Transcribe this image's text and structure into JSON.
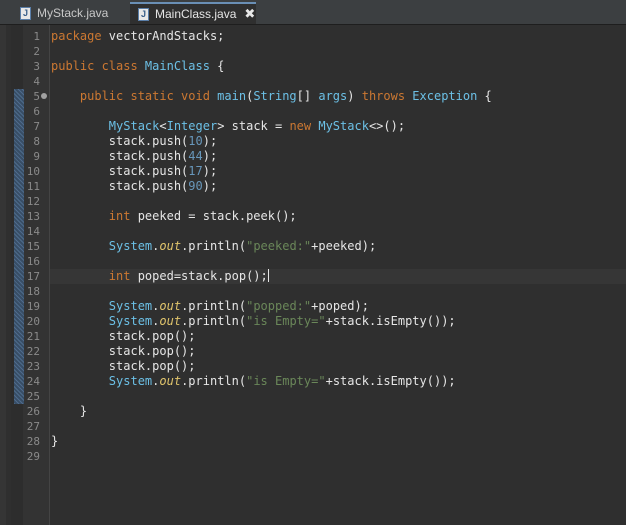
{
  "tabs": [
    {
      "label": "MyStack.java",
      "icon": "java-file-icon",
      "active": false
    },
    {
      "label": "MainClass.java",
      "icon": "java-file-icon",
      "active": true
    }
  ],
  "tab_close": "✖",
  "editor": {
    "line_numbers": [
      "1",
      "2",
      "3",
      "4",
      "5",
      "6",
      "7",
      "8",
      "9",
      "10",
      "11",
      "12",
      "13",
      "14",
      "15",
      "16",
      "17",
      "18",
      "19",
      "20",
      "21",
      "22",
      "23",
      "24",
      "25",
      "26",
      "27",
      "28",
      "29"
    ],
    "current_line": 17,
    "lines": [
      [
        {
          "t": "package ",
          "c": "kw"
        },
        {
          "t": "vectorAndStacks;",
          "c": "pl"
        }
      ],
      [],
      [
        {
          "t": "public class ",
          "c": "kw"
        },
        {
          "t": "MainClass",
          "c": "ms"
        },
        {
          "t": " {",
          "c": "pl"
        }
      ],
      [],
      [
        {
          "t": "    public static void ",
          "c": "kw"
        },
        {
          "t": "main",
          "c": "ms"
        },
        {
          "t": "(",
          "c": "pl"
        },
        {
          "t": "String",
          "c": "ms"
        },
        {
          "t": "[] ",
          "c": "pl"
        },
        {
          "t": "args",
          "c": "ms"
        },
        {
          "t": ") ",
          "c": "pl"
        },
        {
          "t": "throws ",
          "c": "kw"
        },
        {
          "t": "Exception",
          "c": "ms"
        },
        {
          "t": " {",
          "c": "pl"
        }
      ],
      [],
      [
        {
          "t": "        ",
          "c": "pl"
        },
        {
          "t": "MyStack",
          "c": "ms"
        },
        {
          "t": "<",
          "c": "pl"
        },
        {
          "t": "Integer",
          "c": "ms"
        },
        {
          "t": "> ",
          "c": "pl"
        },
        {
          "t": "stack",
          "c": "vr"
        },
        {
          "t": " = ",
          "c": "pl"
        },
        {
          "t": "new ",
          "c": "kw"
        },
        {
          "t": "MyStack",
          "c": "ms"
        },
        {
          "t": "<>();",
          "c": "pl"
        }
      ],
      [
        {
          "t": "        stack.push(",
          "c": "pl"
        },
        {
          "t": "10",
          "c": "num"
        },
        {
          "t": ");",
          "c": "pl"
        }
      ],
      [
        {
          "t": "        stack.push(",
          "c": "pl"
        },
        {
          "t": "44",
          "c": "num"
        },
        {
          "t": ");",
          "c": "pl"
        }
      ],
      [
        {
          "t": "        stack.push(",
          "c": "pl"
        },
        {
          "t": "17",
          "c": "num"
        },
        {
          "t": ");",
          "c": "pl"
        }
      ],
      [
        {
          "t": "        stack.push(",
          "c": "pl"
        },
        {
          "t": "90",
          "c": "num"
        },
        {
          "t": ");",
          "c": "pl"
        }
      ],
      [],
      [
        {
          "t": "        ",
          "c": "pl"
        },
        {
          "t": "int ",
          "c": "kw"
        },
        {
          "t": "peeked = stack.peek();",
          "c": "pl"
        }
      ],
      [],
      [
        {
          "t": "        ",
          "c": "pl"
        },
        {
          "t": "System",
          "c": "ms"
        },
        {
          "t": ".",
          "c": "pl"
        },
        {
          "t": "out",
          "c": "fld"
        },
        {
          "t": ".println(",
          "c": "pl"
        },
        {
          "t": "\"peeked:\"",
          "c": "str"
        },
        {
          "t": "+peeked);",
          "c": "pl"
        }
      ],
      [],
      [
        {
          "t": "        ",
          "c": "pl"
        },
        {
          "t": "int ",
          "c": "kw"
        },
        {
          "t": "poped=stack.pop();",
          "c": "pl"
        }
      ],
      [],
      [
        {
          "t": "        ",
          "c": "pl"
        },
        {
          "t": "System",
          "c": "ms"
        },
        {
          "t": ".",
          "c": "pl"
        },
        {
          "t": "out",
          "c": "fld"
        },
        {
          "t": ".println(",
          "c": "pl"
        },
        {
          "t": "\"popped:\"",
          "c": "str"
        },
        {
          "t": "+poped);",
          "c": "pl"
        }
      ],
      [
        {
          "t": "        ",
          "c": "pl"
        },
        {
          "t": "System",
          "c": "ms"
        },
        {
          "t": ".",
          "c": "pl"
        },
        {
          "t": "out",
          "c": "fld"
        },
        {
          "t": ".println(",
          "c": "pl"
        },
        {
          "t": "\"is Empty=\"",
          "c": "str"
        },
        {
          "t": "+stack.isEmpty());",
          "c": "pl"
        }
      ],
      [
        {
          "t": "        stack.pop();",
          "c": "pl"
        }
      ],
      [
        {
          "t": "        stack.pop();",
          "c": "pl"
        }
      ],
      [
        {
          "t": "        stack.pop();",
          "c": "pl"
        }
      ],
      [
        {
          "t": "        ",
          "c": "pl"
        },
        {
          "t": "System",
          "c": "ms"
        },
        {
          "t": ".",
          "c": "pl"
        },
        {
          "t": "out",
          "c": "fld"
        },
        {
          "t": ".println(",
          "c": "pl"
        },
        {
          "t": "\"is Empty=\"",
          "c": "str"
        },
        {
          "t": "+stack.isEmpty());",
          "c": "pl"
        }
      ],
      [],
      [
        {
          "t": "    }",
          "c": "pl"
        }
      ],
      [],
      [
        {
          "t": "}",
          "c": "pl"
        }
      ],
      []
    ]
  },
  "colors": {
    "background": "#2f2f2f",
    "keyword": "#cc7832",
    "type": "#6cc0e6",
    "number": "#6897bb",
    "string": "#6a8759",
    "field": "#e0c46c"
  }
}
